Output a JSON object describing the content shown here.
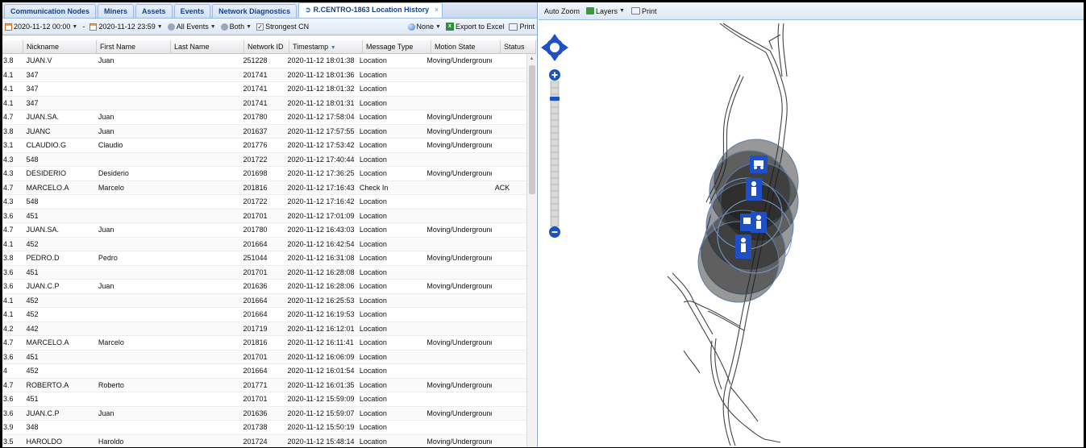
{
  "tabs": [
    {
      "label": "Communication Nodes"
    },
    {
      "label": "Miners"
    },
    {
      "label": "Assets"
    },
    {
      "label": "Events"
    },
    {
      "label": "Network Diagnostics"
    },
    {
      "label": "R.CENTRO-1863 Location History"
    }
  ],
  "toolbar": {
    "date_from": "2020-11-12 00:00",
    "separator": "-",
    "date_to": "2020-11-12 23:59",
    "events_filter": "All Events",
    "direction_filter": "Both",
    "strongest_cn_label": "Strongest CN",
    "strongest_cn_checked": "✓",
    "none_label": "None",
    "export_label": "Export to Excel",
    "print_label": "Print"
  },
  "grid": {
    "columns": [
      "",
      "Nickname",
      "First Name",
      "Last Name",
      "Network ID",
      "Timestamp",
      "Message Type",
      "Motion State",
      "Status"
    ],
    "rows": [
      [
        "3.8",
        "JUAN.V",
        "Juan",
        "",
        "251228",
        "2020-11-12 18:01:38",
        "Location",
        "Moving/Underground",
        ""
      ],
      [
        "4.1",
        "347",
        "",
        "",
        "201741",
        "2020-11-12 18:01:36",
        "Location",
        "",
        ""
      ],
      [
        "4.1",
        "347",
        "",
        "",
        "201741",
        "2020-11-12 18:01:32",
        "Location",
        "",
        ""
      ],
      [
        "4.1",
        "347",
        "",
        "",
        "201741",
        "2020-11-12 18:01:31",
        "Location",
        "",
        ""
      ],
      [
        "4.7",
        "JUAN.SA.",
        "Juan",
        "",
        "201780",
        "2020-11-12 17:58:04",
        "Location",
        "Moving/Underground",
        ""
      ],
      [
        "3.8",
        "JUANC",
        "Juan",
        "",
        "201637",
        "2020-11-12 17:57:55",
        "Location",
        "Moving/Underground",
        ""
      ],
      [
        "3.1",
        "CLAUDIO.G",
        "Claudio",
        "",
        "201776",
        "2020-11-12 17:53:42",
        "Location",
        "Moving/Underground",
        ""
      ],
      [
        "4.3",
        "548",
        "",
        "",
        "201722",
        "2020-11-12 17:40:44",
        "Location",
        "",
        ""
      ],
      [
        "4.3",
        "DESIDERIO",
        "Desiderio",
        "",
        "201698",
        "2020-11-12 17:36:25",
        "Location",
        "Moving/Underground",
        ""
      ],
      [
        "4.7",
        "MARCELO.A",
        "Marcelo",
        "",
        "201816",
        "2020-11-12 17:16:43",
        "Check In",
        "",
        "ACK"
      ],
      [
        "4.3",
        "548",
        "",
        "",
        "201722",
        "2020-11-12 17:16:42",
        "Location",
        "",
        ""
      ],
      [
        "3.6",
        "451",
        "",
        "",
        "201701",
        "2020-11-12 17:01:09",
        "Location",
        "",
        ""
      ],
      [
        "4.7",
        "JUAN.SA.",
        "Juan",
        "",
        "201780",
        "2020-11-12 16:43:03",
        "Location",
        "Moving/Underground",
        ""
      ],
      [
        "4.1",
        "452",
        "",
        "",
        "201664",
        "2020-11-12 16:42:54",
        "Location",
        "",
        ""
      ],
      [
        "3.8",
        "PEDRO.D",
        "Pedro",
        "",
        "251044",
        "2020-11-12 16:31:08",
        "Location",
        "Moving/Underground",
        ""
      ],
      [
        "3.6",
        "451",
        "",
        "",
        "201701",
        "2020-11-12 16:28:08",
        "Location",
        "",
        ""
      ],
      [
        "3.6",
        "JUAN.C.P",
        "Juan",
        "",
        "201636",
        "2020-11-12 16:28:06",
        "Location",
        "Moving/Underground",
        ""
      ],
      [
        "4.1",
        "452",
        "",
        "",
        "201664",
        "2020-11-12 16:25:53",
        "Location",
        "",
        ""
      ],
      [
        "4.1",
        "452",
        "",
        "",
        "201664",
        "2020-11-12 16:19:53",
        "Location",
        "",
        ""
      ],
      [
        "4.2",
        "442",
        "",
        "",
        "201719",
        "2020-11-12 16:12:01",
        "Location",
        "",
        ""
      ],
      [
        "4.7",
        "MARCELO.A",
        "Marcelo",
        "",
        "201816",
        "2020-11-12 16:11:41",
        "Location",
        "Moving/Underground",
        ""
      ],
      [
        "3.6",
        "451",
        "",
        "",
        "201701",
        "2020-11-12 16:06:09",
        "Location",
        "",
        ""
      ],
      [
        "4",
        "452",
        "",
        "",
        "201664",
        "2020-11-12 16:01:54",
        "Location",
        "",
        ""
      ],
      [
        "4.7",
        "ROBERTO.A",
        "Roberto",
        "",
        "201771",
        "2020-11-12 16:01:35",
        "Location",
        "Moving/Underground",
        ""
      ],
      [
        "3.6",
        "451",
        "",
        "",
        "201701",
        "2020-11-12 15:59:09",
        "Location",
        "",
        ""
      ],
      [
        "3.6",
        "JUAN.C.P",
        "Juan",
        "",
        "201636",
        "2020-11-12 15:59:07",
        "Location",
        "Moving/Underground",
        ""
      ],
      [
        "3.9",
        "348",
        "",
        "",
        "201738",
        "2020-11-12 15:50:19",
        "Location",
        "",
        ""
      ],
      [
        "3.5",
        "HAROLDO",
        "Haroldo",
        "",
        "201724",
        "2020-11-12 15:48:14",
        "Location",
        "Moving/Underground",
        ""
      ]
    ]
  },
  "map_toolbar": {
    "auto_zoom_label": "Auto Zoom",
    "layers_label": "Layers",
    "print_label": "Print"
  },
  "map": {
    "markers": [
      "person-marker",
      "person-marker",
      "person-marker",
      "vehicle-marker"
    ],
    "accent": "#1f4fc4"
  }
}
